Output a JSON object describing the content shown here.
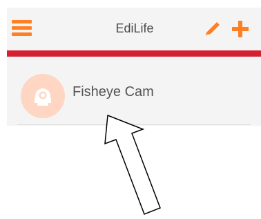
{
  "app": {
    "title": "EdiLife",
    "accent_color": "#ff7f24",
    "divider_color": "#d42030"
  },
  "toolbar": {
    "menu_icon": "hamburger-menu-icon",
    "edit_icon": "pencil-icon",
    "add_icon": "plus-icon"
  },
  "devices": [
    {
      "name": "Fisheye Cam",
      "icon": "camera-icon"
    }
  ]
}
